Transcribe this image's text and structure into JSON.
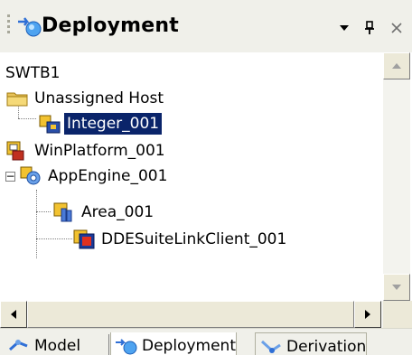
{
  "panel": {
    "title": "Deployment",
    "title_icon": "deployment-icon",
    "menu_icon": "dropdown-arrow-icon",
    "pin_icon": "pin-icon",
    "close_icon": "close-icon"
  },
  "tree": {
    "root": "SWTB1",
    "nodes": [
      {
        "label": "Unassigned Host",
        "icon": "folder-icon"
      },
      {
        "label": "Integer_001",
        "icon": "integer-object-icon",
        "selected": true
      },
      {
        "label": "WinPlatform_001",
        "icon": "platform-icon"
      },
      {
        "label": "AppEngine_001",
        "icon": "app-engine-icon",
        "expander": "−"
      },
      {
        "label": "Area_001",
        "icon": "area-icon"
      },
      {
        "label": "DDESuiteLinkClient_001",
        "icon": "device-integration-icon"
      }
    ]
  },
  "scrollbars": {
    "up_icon": "scroll-up-arrow-icon",
    "down_icon": "scroll-down-arrow-icon",
    "left_icon": "scroll-left-arrow-icon",
    "right_icon": "scroll-right-arrow-icon"
  },
  "tabs": [
    {
      "label": "Model",
      "icon": "model-icon"
    },
    {
      "label": "Deployment",
      "icon": "deployment-icon",
      "active": true
    },
    {
      "label": "Derivation",
      "icon": "derivation-icon"
    }
  ],
  "colors": {
    "selection": "#0a246a",
    "header_bg": "#f0f0ea",
    "scroll_bg": "#ece9d8"
  }
}
